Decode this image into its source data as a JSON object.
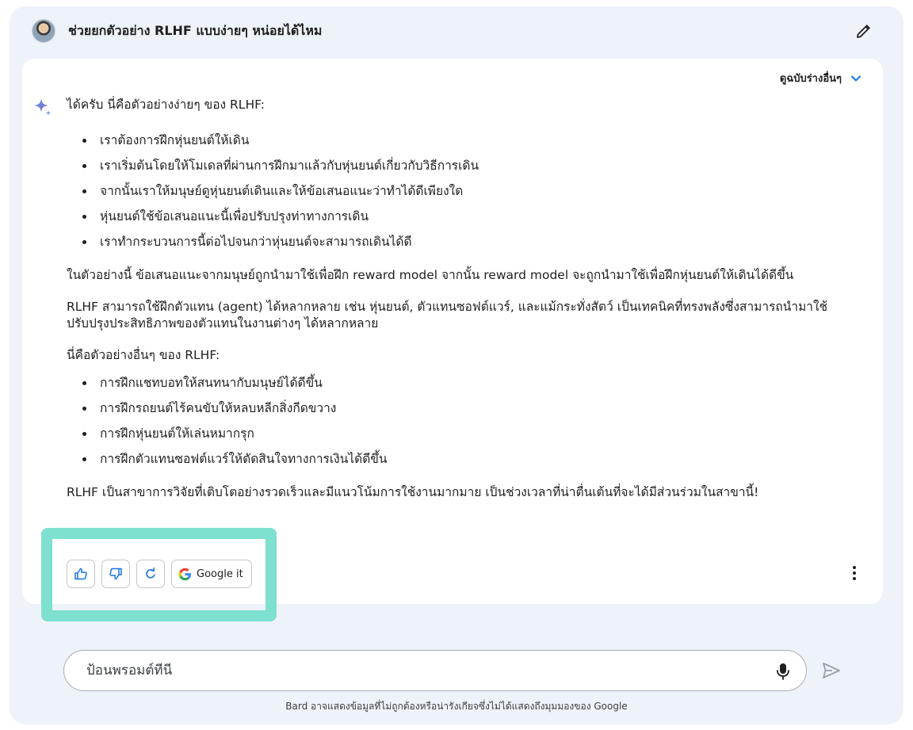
{
  "prompt": {
    "text": "ช่วยยกตัวอย่าง RLHF แบบง่ายๆ หน่อยได้ไหม"
  },
  "response": {
    "view_drafts_label": "ดูฉบับร่างอื่นๆ",
    "intro": "ได้ครับ นี่คือตัวอย่างง่ายๆ ของ RLHF:",
    "steps": [
      "เราต้องการฝึกหุ่นยนต์ให้เดิน",
      "เราเริ่มต้นโดยให้โมเดลที่ผ่านการฝึกมาแล้วกับหุ่นยนต์เกี่ยวกับวิธีการเดิน",
      "จากนั้นเราให้มนุษย์ดูหุ่นยนต์เดินและให้ข้อเสนอแนะว่าทำได้ดีเพียงใด",
      "หุ่นยนต์ใช้ข้อเสนอแนะนี้เพื่อปรับปรุงท่าทางการเดิน",
      "เราทำกระบวนการนี้ต่อไปจนกว่าหุ่นยนต์จะสามารถเดินได้ดี"
    ],
    "paragraph_1": "ในตัวอย่างนี้ ข้อเสนอแนะจากมนุษย์ถูกนำมาใช้เพื่อฝึก reward model จากนั้น reward model จะถูกนำมาใช้เพื่อฝึกหุ่นยนต์ให้เดินได้ดีขึ้น",
    "paragraph_2": "RLHF สามารถใช้ฝึกตัวแทน (agent) ได้หลากหลาย เช่น หุ่นยนต์, ตัวแทนซอฟต์แวร์, และแม้กระทั่งสัตว์ เป็นเทคนิคที่ทรงพลังซึ่งสามารถนำมาใช้ปรับปรุงประสิทธิภาพของตัวแทนในงานต่างๆ ได้หลากหลาย",
    "examples_heading": "นี่คือตัวอย่างอื่นๆ ของ RLHF:",
    "examples": [
      "การฝึกแชทบอทให้สนทนากับมนุษย์ได้ดีขึ้น",
      "การฝึกรถยนต์ไร้คนขับให้หลบหลีกสิ่งกีดขวาง",
      "การฝึกหุ่นยนต์ให้เล่นหมากรุก",
      "การฝึกตัวแทนซอฟต์แวร์ให้ตัดสินใจทางการเงินได้ดีขึ้น"
    ],
    "closing": "RLHF เป็นสาขาการวิจัยที่เติบโตอย่างรวดเร็วและมีแนวโน้มการใช้งานมากมาย เป็นช่วงเวลาที่น่าตื่นเต้นที่จะได้มีส่วนร่วมในสาขานี้!"
  },
  "actions": {
    "google_it_label": "Google it"
  },
  "input": {
    "placeholder": "ป้อนพรอมต์ที่นี่"
  },
  "footer": {
    "disclaimer": "Bard อาจแสดงข้อมูลที่ไม่ถูกต้องหรือน่ารังเกียจซึ่งไม่ได้แสดงถึงมุมมองของ Google"
  },
  "colors": {
    "background": "#eef2f9",
    "highlight": "#7ee0cf",
    "google_blue": "#4285F4",
    "google_red": "#EA4335",
    "google_yellow": "#FBBC05",
    "google_green": "#34A853"
  },
  "icons": [
    "avatar",
    "edit-icon",
    "chevron-down-icon",
    "bard-sparkle-icon",
    "thumbs-up-icon",
    "thumbs-down-icon",
    "regenerate-icon",
    "google-g-icon",
    "more-vert-icon",
    "mic-icon",
    "send-icon"
  ]
}
